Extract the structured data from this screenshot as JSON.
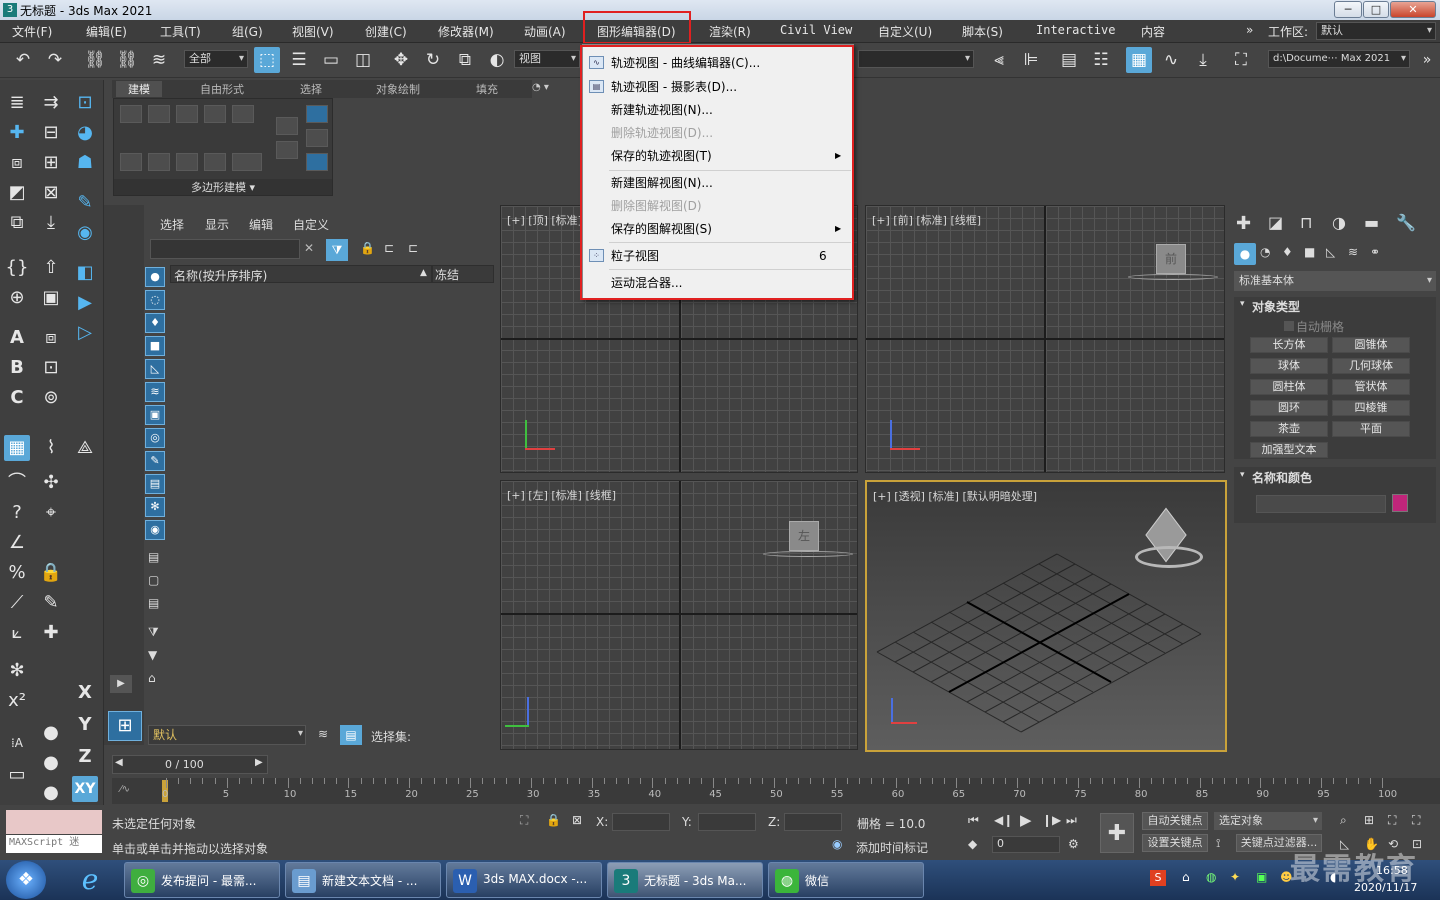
{
  "window": {
    "title": "无标题 - 3ds Max 2021",
    "icon": "3ds-max-icon",
    "minimize": "─",
    "maximize": "□",
    "close": "✕"
  },
  "menubar": {
    "items": [
      "文件(F)",
      "编辑(E)",
      "工具(T)",
      "组(G)",
      "视图(V)",
      "创建(C)",
      "修改器(M)",
      "动画(A)",
      "图形编辑器(D)",
      "渲染(R)",
      "Civil View",
      "自定义(U)",
      "脚本(S)",
      "Interactive",
      "内容"
    ],
    "overflow": "»",
    "workspace_label": "工作区:",
    "workspace_value": "默认"
  },
  "toolbar": {
    "selection_filter": "全部",
    "ref_coord": "视图",
    "path": "d:\\Docume⋯ Max 2021",
    "overflow": "»"
  },
  "ribbon": {
    "tabs": [
      "建模",
      "自由形式",
      "选择",
      "对象绘制",
      "填充"
    ],
    "panel_label": "多边形建模 ▾"
  },
  "graph_editors_menu": {
    "items": [
      {
        "label": "轨迹视图 - 曲线编辑器(C)...",
        "icon": "curve-editor-icon",
        "enabled": true
      },
      {
        "label": "轨迹视图 - 摄影表(D)...",
        "icon": "dope-sheet-icon",
        "enabled": true
      },
      {
        "label": "新建轨迹视图(N)...",
        "enabled": true
      },
      {
        "label": "删除轨迹视图(D)...",
        "enabled": false
      },
      {
        "label": "保存的轨迹视图(T)",
        "enabled": true,
        "submenu": true
      },
      {
        "label": "新建图解视图(N)...",
        "enabled": true
      },
      {
        "label": "删除图解视图(D)",
        "enabled": false
      },
      {
        "label": "保存的图解视图(S)",
        "enabled": true,
        "submenu": true
      },
      {
        "label": "粒子视图",
        "icon": "particle-view-icon",
        "enabled": true,
        "shortcut": "6"
      },
      {
        "label": "运动混合器...",
        "enabled": true
      }
    ]
  },
  "scene_explorer": {
    "tabs": [
      "选择",
      "显示",
      "编辑",
      "自定义"
    ],
    "search_placeholder": "",
    "column_name": "名称(按升序排序)",
    "column_sort": "▲",
    "column_freeze": "冻结",
    "layer_value": "默认",
    "selection_set_label": "选择集:"
  },
  "viewports": [
    {
      "label": "[+] [顶] [标准] [线框]"
    },
    {
      "label": "[+] [前] [标准] [线框]",
      "cube": "前"
    },
    {
      "label": "[+] [左] [标准] [线框]",
      "cube": "左"
    },
    {
      "label": "[+] [透视] [标准] [默认明暗处理]"
    }
  ],
  "command_panel": {
    "category": "标准基本体",
    "object_type_header": "对象类型",
    "autogrid": "自动栅格",
    "primitives": [
      "长方体",
      "圆锥体",
      "球体",
      "几何球体",
      "圆柱体",
      "管状体",
      "圆环",
      "四棱锥",
      "茶壶",
      "平面",
      "加强型文本"
    ],
    "name_color_header": "名称和颜色",
    "object_color": "#c0257a"
  },
  "timeline": {
    "frame_display": "0 / 100",
    "ticks": [
      "0",
      "5",
      "10",
      "15",
      "20",
      "25",
      "30",
      "35",
      "40",
      "45",
      "50",
      "55",
      "60",
      "65",
      "70",
      "75",
      "80",
      "85",
      "90",
      "95",
      "100"
    ]
  },
  "status": {
    "maxscript": "MAXScript 迷",
    "line1": "未选定任何对象",
    "line2": "单击或单击并拖动以选择对象",
    "x_label": "X:",
    "y_label": "Y:",
    "z_label": "Z:",
    "grid": "栅格 = 10.0",
    "add_time_tag": "添加时间标记",
    "autokey": "自动关键点",
    "setkey": "设置关键点",
    "selected_obj": "选定对象",
    "key_filter": "关键点过滤器...",
    "frame_value": "0"
  },
  "taskbar": {
    "items": [
      "发布提问 - 最需...",
      "新建文本文档 - ...",
      "3ds MAX.docx -...",
      "无标题 - 3ds Ma...",
      "微信"
    ],
    "time": "16:58",
    "date": "2020/11/17",
    "watermark": "最需教育"
  }
}
